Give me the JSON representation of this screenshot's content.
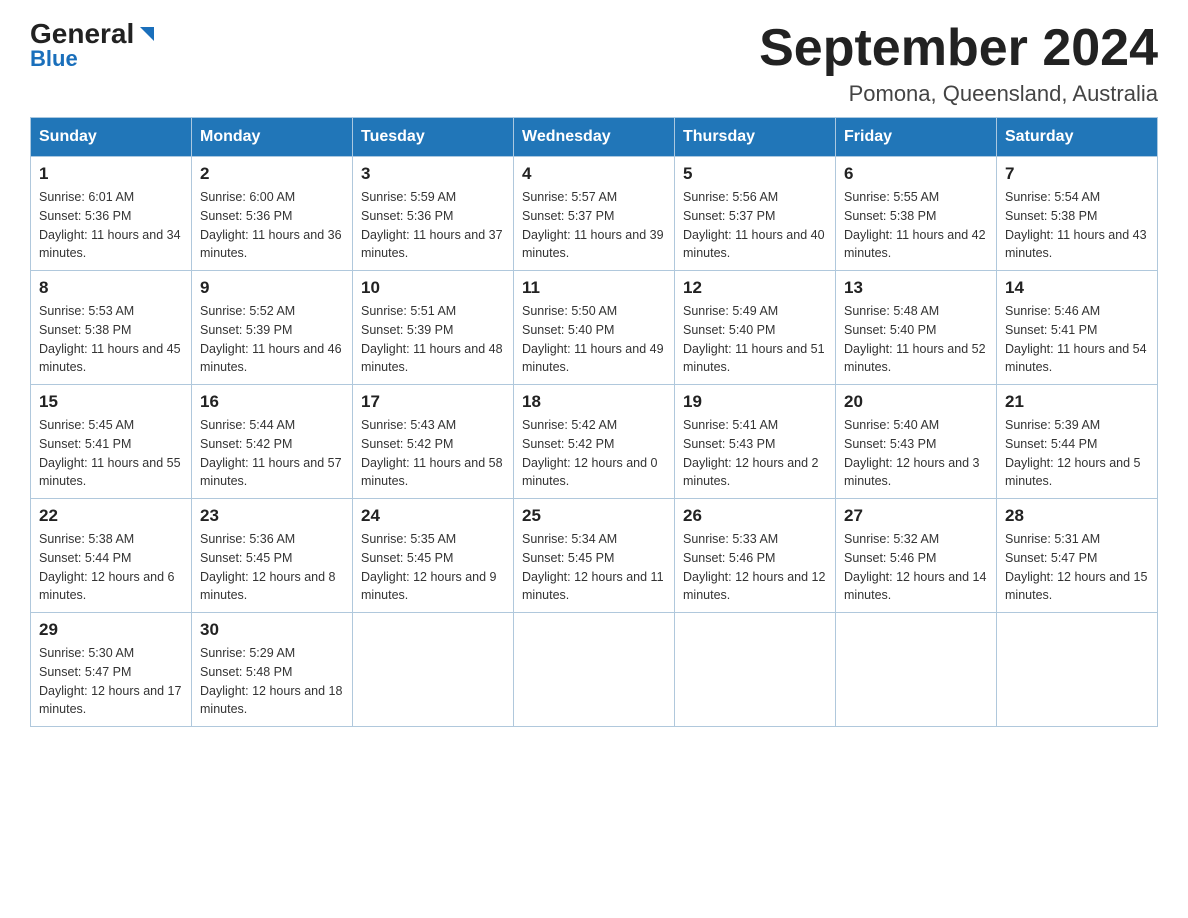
{
  "header": {
    "logo_general": "General",
    "logo_blue": "Blue",
    "month_title": "September 2024",
    "location": "Pomona, Queensland, Australia"
  },
  "days_of_week": [
    "Sunday",
    "Monday",
    "Tuesday",
    "Wednesday",
    "Thursday",
    "Friday",
    "Saturday"
  ],
  "weeks": [
    [
      {
        "day": "1",
        "sunrise": "6:01 AM",
        "sunset": "5:36 PM",
        "daylight": "11 hours and 34 minutes."
      },
      {
        "day": "2",
        "sunrise": "6:00 AM",
        "sunset": "5:36 PM",
        "daylight": "11 hours and 36 minutes."
      },
      {
        "day": "3",
        "sunrise": "5:59 AM",
        "sunset": "5:36 PM",
        "daylight": "11 hours and 37 minutes."
      },
      {
        "day": "4",
        "sunrise": "5:57 AM",
        "sunset": "5:37 PM",
        "daylight": "11 hours and 39 minutes."
      },
      {
        "day": "5",
        "sunrise": "5:56 AM",
        "sunset": "5:37 PM",
        "daylight": "11 hours and 40 minutes."
      },
      {
        "day": "6",
        "sunrise": "5:55 AM",
        "sunset": "5:38 PM",
        "daylight": "11 hours and 42 minutes."
      },
      {
        "day": "7",
        "sunrise": "5:54 AM",
        "sunset": "5:38 PM",
        "daylight": "11 hours and 43 minutes."
      }
    ],
    [
      {
        "day": "8",
        "sunrise": "5:53 AM",
        "sunset": "5:38 PM",
        "daylight": "11 hours and 45 minutes."
      },
      {
        "day": "9",
        "sunrise": "5:52 AM",
        "sunset": "5:39 PM",
        "daylight": "11 hours and 46 minutes."
      },
      {
        "day": "10",
        "sunrise": "5:51 AM",
        "sunset": "5:39 PM",
        "daylight": "11 hours and 48 minutes."
      },
      {
        "day": "11",
        "sunrise": "5:50 AM",
        "sunset": "5:40 PM",
        "daylight": "11 hours and 49 minutes."
      },
      {
        "day": "12",
        "sunrise": "5:49 AM",
        "sunset": "5:40 PM",
        "daylight": "11 hours and 51 minutes."
      },
      {
        "day": "13",
        "sunrise": "5:48 AM",
        "sunset": "5:40 PM",
        "daylight": "11 hours and 52 minutes."
      },
      {
        "day": "14",
        "sunrise": "5:46 AM",
        "sunset": "5:41 PM",
        "daylight": "11 hours and 54 minutes."
      }
    ],
    [
      {
        "day": "15",
        "sunrise": "5:45 AM",
        "sunset": "5:41 PM",
        "daylight": "11 hours and 55 minutes."
      },
      {
        "day": "16",
        "sunrise": "5:44 AM",
        "sunset": "5:42 PM",
        "daylight": "11 hours and 57 minutes."
      },
      {
        "day": "17",
        "sunrise": "5:43 AM",
        "sunset": "5:42 PM",
        "daylight": "11 hours and 58 minutes."
      },
      {
        "day": "18",
        "sunrise": "5:42 AM",
        "sunset": "5:42 PM",
        "daylight": "12 hours and 0 minutes."
      },
      {
        "day": "19",
        "sunrise": "5:41 AM",
        "sunset": "5:43 PM",
        "daylight": "12 hours and 2 minutes."
      },
      {
        "day": "20",
        "sunrise": "5:40 AM",
        "sunset": "5:43 PM",
        "daylight": "12 hours and 3 minutes."
      },
      {
        "day": "21",
        "sunrise": "5:39 AM",
        "sunset": "5:44 PM",
        "daylight": "12 hours and 5 minutes."
      }
    ],
    [
      {
        "day": "22",
        "sunrise": "5:38 AM",
        "sunset": "5:44 PM",
        "daylight": "12 hours and 6 minutes."
      },
      {
        "day": "23",
        "sunrise": "5:36 AM",
        "sunset": "5:45 PM",
        "daylight": "12 hours and 8 minutes."
      },
      {
        "day": "24",
        "sunrise": "5:35 AM",
        "sunset": "5:45 PM",
        "daylight": "12 hours and 9 minutes."
      },
      {
        "day": "25",
        "sunrise": "5:34 AM",
        "sunset": "5:45 PM",
        "daylight": "12 hours and 11 minutes."
      },
      {
        "day": "26",
        "sunrise": "5:33 AM",
        "sunset": "5:46 PM",
        "daylight": "12 hours and 12 minutes."
      },
      {
        "day": "27",
        "sunrise": "5:32 AM",
        "sunset": "5:46 PM",
        "daylight": "12 hours and 14 minutes."
      },
      {
        "day": "28",
        "sunrise": "5:31 AM",
        "sunset": "5:47 PM",
        "daylight": "12 hours and 15 minutes."
      }
    ],
    [
      {
        "day": "29",
        "sunrise": "5:30 AM",
        "sunset": "5:47 PM",
        "daylight": "12 hours and 17 minutes."
      },
      {
        "day": "30",
        "sunrise": "5:29 AM",
        "sunset": "5:48 PM",
        "daylight": "12 hours and 18 minutes."
      },
      null,
      null,
      null,
      null,
      null
    ]
  ]
}
